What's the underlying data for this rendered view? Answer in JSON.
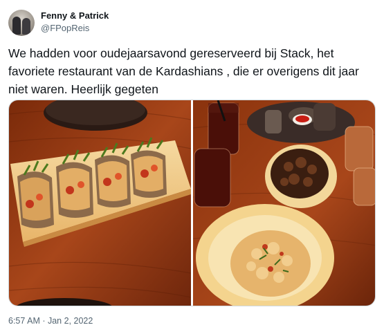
{
  "author": {
    "name": "Fenny & Patrick",
    "handle": "@FPopReis"
  },
  "tweet": {
    "text": "We hadden voor oudejaarsavond gereserveerd bij Stack, het favoriete restaurant van de Kardashians , die er overigens dit jaar niet waren. Heerlijk gegeten",
    "timestamp": "6:57 AM · Jan 2, 2022"
  },
  "media": {
    "count": 2,
    "photos": [
      {
        "subject": "tacos on a white rectangular plate on a wooden table"
      },
      {
        "subject": "drinks, a bowl of fried vegetables and a plate of risotto on a wooden table"
      }
    ]
  },
  "colors": {
    "text": "#0f1419",
    "secondary": "#536471",
    "border": "#cfd9de",
    "wood": "#9a3f12"
  }
}
